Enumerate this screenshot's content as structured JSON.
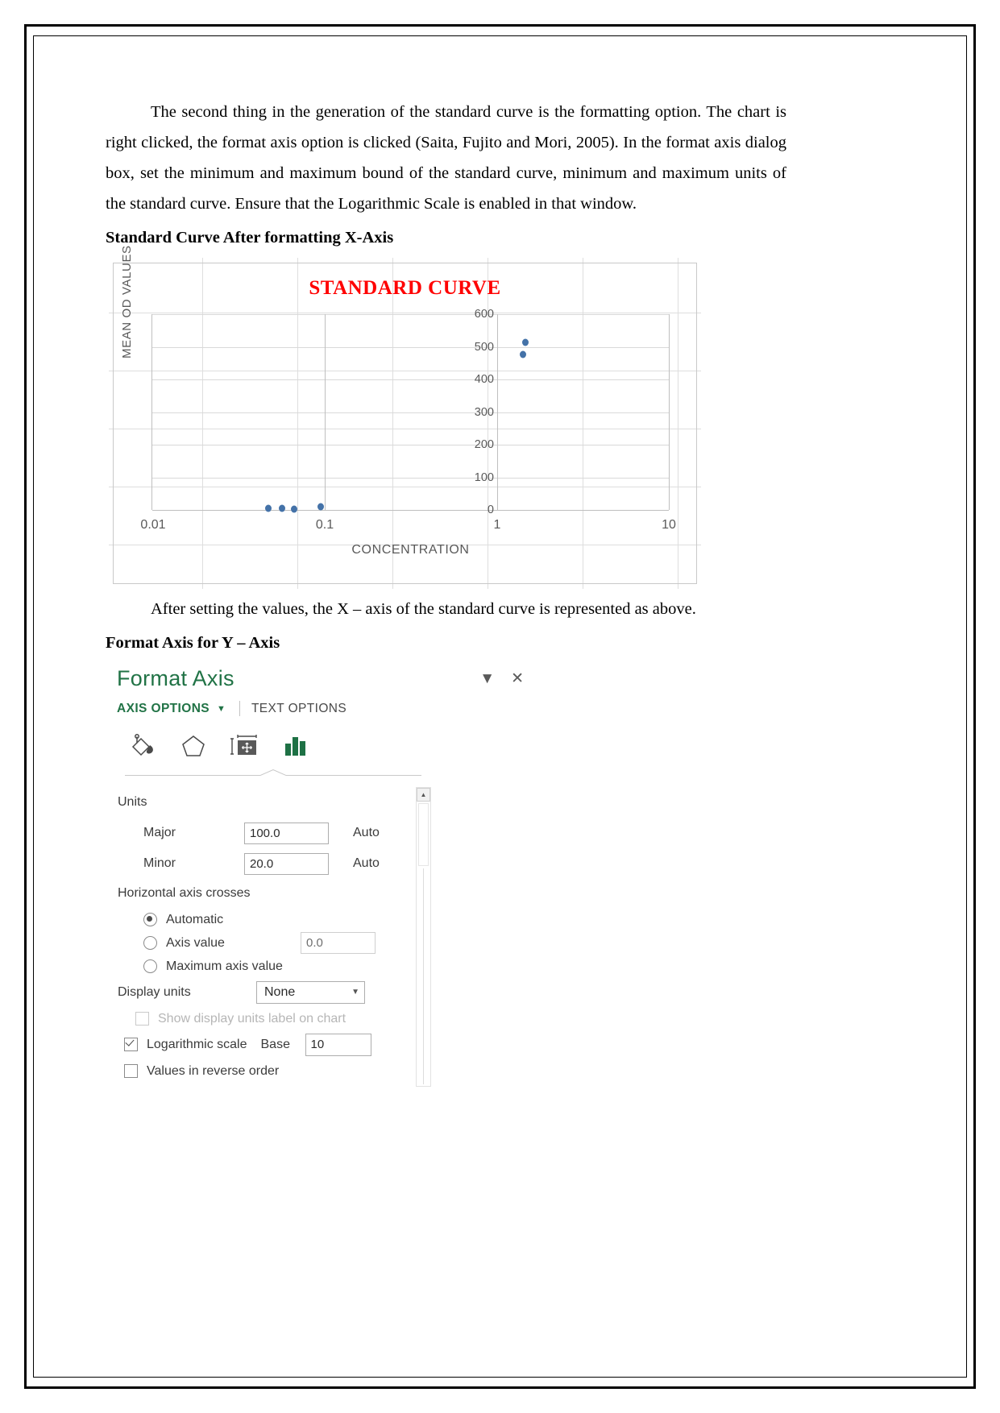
{
  "document": {
    "paragraph1": "The second thing in the generation of the standard curve is the formatting option. The chart is right clicked, the format axis option is clicked (Saita, Fujito and Mori, 2005). In the format axis dialog box, set the minimum and maximum bound of the standard curve, minimum and maximum units of the standard curve. Ensure that the Logarithmic Scale is enabled in that window.",
    "heading1": "Standard Curve After formatting X-Axis",
    "caption1": "After setting the values, the X – axis of the standard curve is represented as above.",
    "heading2": "Format Axis for Y – Axis"
  },
  "chart_data": {
    "type": "scatter",
    "title": "STANDARD CURVE",
    "title_color": "#ff0000",
    "xlabel": "CONCENTRATION",
    "ylabel": "MEAN OD VALUES",
    "x_scale": "log",
    "x_ticks": [
      "0.01",
      "0.1",
      "1",
      "10"
    ],
    "x_tick_values": [
      0.01,
      0.1,
      1,
      10
    ],
    "xlim": [
      0.01,
      10
    ],
    "y_ticks": [
      "0",
      "100",
      "200",
      "300",
      "400",
      "500",
      "600"
    ],
    "y_tick_values": [
      0,
      100,
      200,
      300,
      400,
      500,
      600
    ],
    "ylim": [
      0,
      600
    ],
    "grid": "horizontal",
    "legend": "none",
    "marker_color": "#4472a8",
    "series": [
      {
        "name": "MEAN OD VALUES",
        "points": [
          {
            "x": 0.041,
            "y": 4
          },
          {
            "x": 0.049,
            "y": 4
          },
          {
            "x": 0.058,
            "y": 3
          },
          {
            "x": 0.083,
            "y": 9
          },
          {
            "x": 1.42,
            "y": 478
          },
          {
            "x": 1.47,
            "y": 515
          }
        ]
      }
    ]
  },
  "format_pane": {
    "title": "Format Axis",
    "collapse_label": "▼",
    "close_label": "✕",
    "tab_axis_options": "AXIS OPTIONS",
    "tab_axis_caret": "▼",
    "tab_text_options": "TEXT OPTIONS",
    "icons": {
      "fill": "fill-bucket-icon",
      "effects": "effects-pentagon-icon",
      "size": "size-properties-icon",
      "axis": "axis-options-chart-icon"
    },
    "units_group_label": "Units",
    "major_label": "Major",
    "major_value": "100.0",
    "major_auto": "Auto",
    "minor_label": "Minor",
    "minor_value": "20.0",
    "minor_auto": "Auto",
    "crosses_group_label": "Horizontal axis crosses",
    "crosses_automatic": "Automatic",
    "crosses_automatic_selected": true,
    "crosses_axis_value": "Axis value",
    "crosses_axis_value_number": "0.0",
    "crosses_maximum": "Maximum axis value",
    "display_units_label": "Display units",
    "display_units_value": "None",
    "show_units_label": "Show display units label on chart",
    "show_units_checked": false,
    "log_scale_label": "Logarithmic scale",
    "log_scale_checked": true,
    "base_label": "Base",
    "base_value": "10",
    "reverse_label": "Values in reverse order",
    "reverse_checked": false
  }
}
